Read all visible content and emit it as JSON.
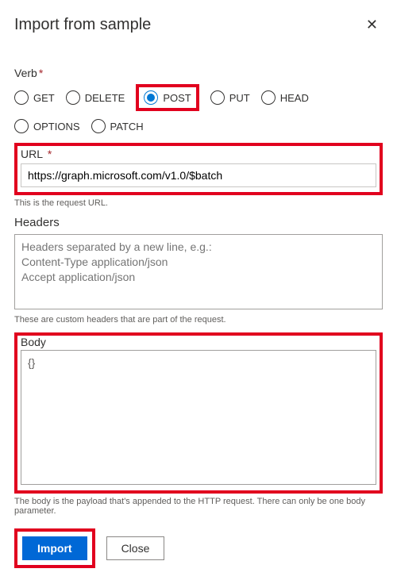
{
  "dialog": {
    "title": "Import from sample"
  },
  "verb": {
    "label": "Verb",
    "options": {
      "get": "GET",
      "delete": "DELETE",
      "post": "POST",
      "put": "PUT",
      "head": "HEAD",
      "options": "OPTIONS",
      "patch": "PATCH"
    },
    "selected": "post"
  },
  "url": {
    "label": "URL",
    "value": "https://graph.microsoft.com/v1.0/$batch",
    "helper": "This is the request URL."
  },
  "headers": {
    "label": "Headers",
    "placeholder": "Headers separated by a new line, e.g.:\nContent-Type application/json\nAccept application/json",
    "helper": "These are custom headers that are part of the request."
  },
  "body": {
    "label": "Body",
    "value": "{}",
    "helper": "The body is the payload that's appended to the HTTP request. There can only be one body parameter."
  },
  "buttons": {
    "import": "Import",
    "close": "Close"
  }
}
